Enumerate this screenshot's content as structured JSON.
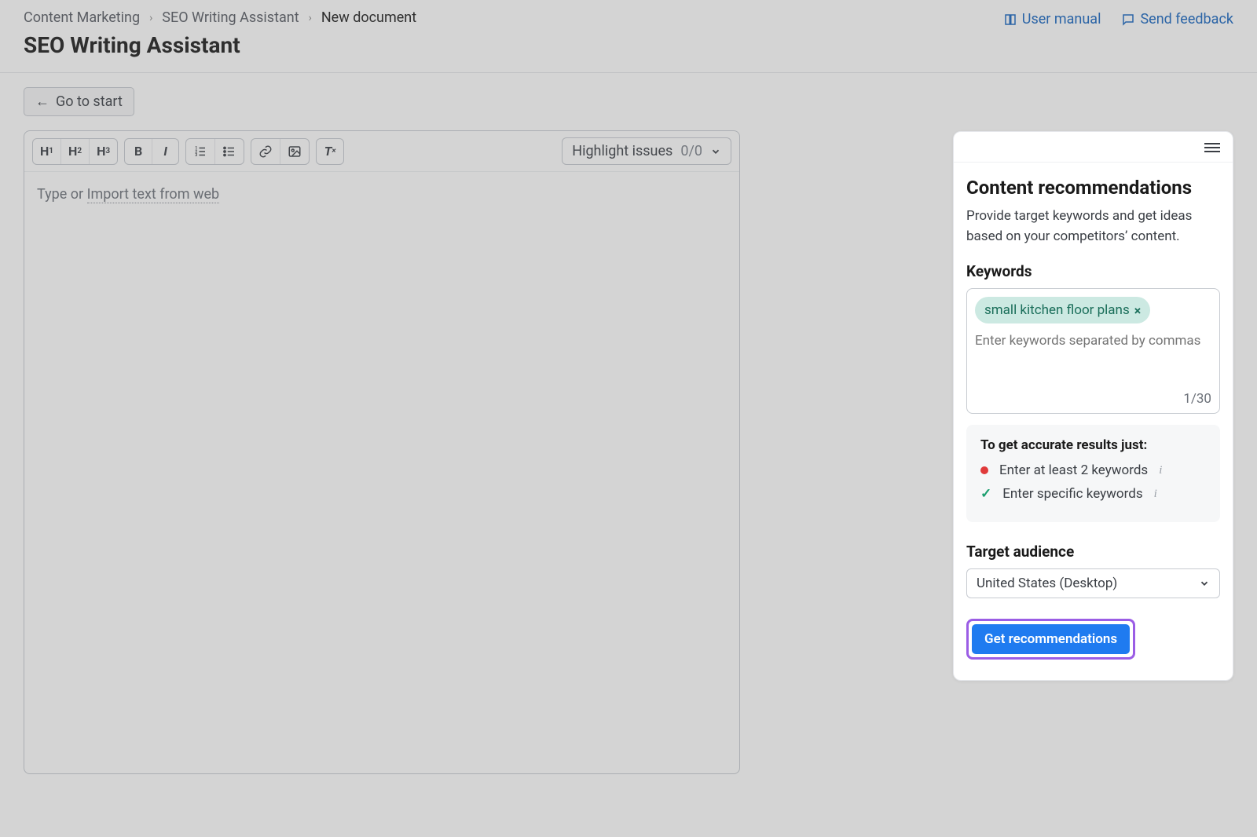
{
  "breadcrumb": {
    "items": [
      "Content Marketing",
      "SEO Writing Assistant",
      "New document"
    ]
  },
  "header": {
    "page_title": "SEO Writing Assistant",
    "user_manual": "User manual",
    "send_feedback": "Send feedback"
  },
  "controls": {
    "go_to_start": "Go to start"
  },
  "toolbar": {
    "h1": "H",
    "h1s": "1",
    "h2": "H",
    "h2s": "2",
    "h3": "H",
    "h3s": "3",
    "bold": "B",
    "italic": "I",
    "highlight_label": "Highlight issues",
    "highlight_count": "0/0"
  },
  "editor": {
    "placeholder_prefix": "Type or ",
    "import_link": "Import text from web"
  },
  "panel": {
    "title": "Content recommendations",
    "description": "Provide target keywords and get ideas based on your competitors’ content.",
    "keywords_label": "Keywords",
    "keyword_tag": "small kitchen floor plans",
    "keyword_placeholder": "Enter keywords separated by commas",
    "keyword_count": "1/30",
    "tips_title": "To get accurate results just:",
    "tip1": "Enter at least 2 keywords",
    "tip2": "Enter specific keywords",
    "audience_label": "Target audience",
    "audience_value": "United States (Desktop)",
    "cta_label": "Get recommendations"
  }
}
